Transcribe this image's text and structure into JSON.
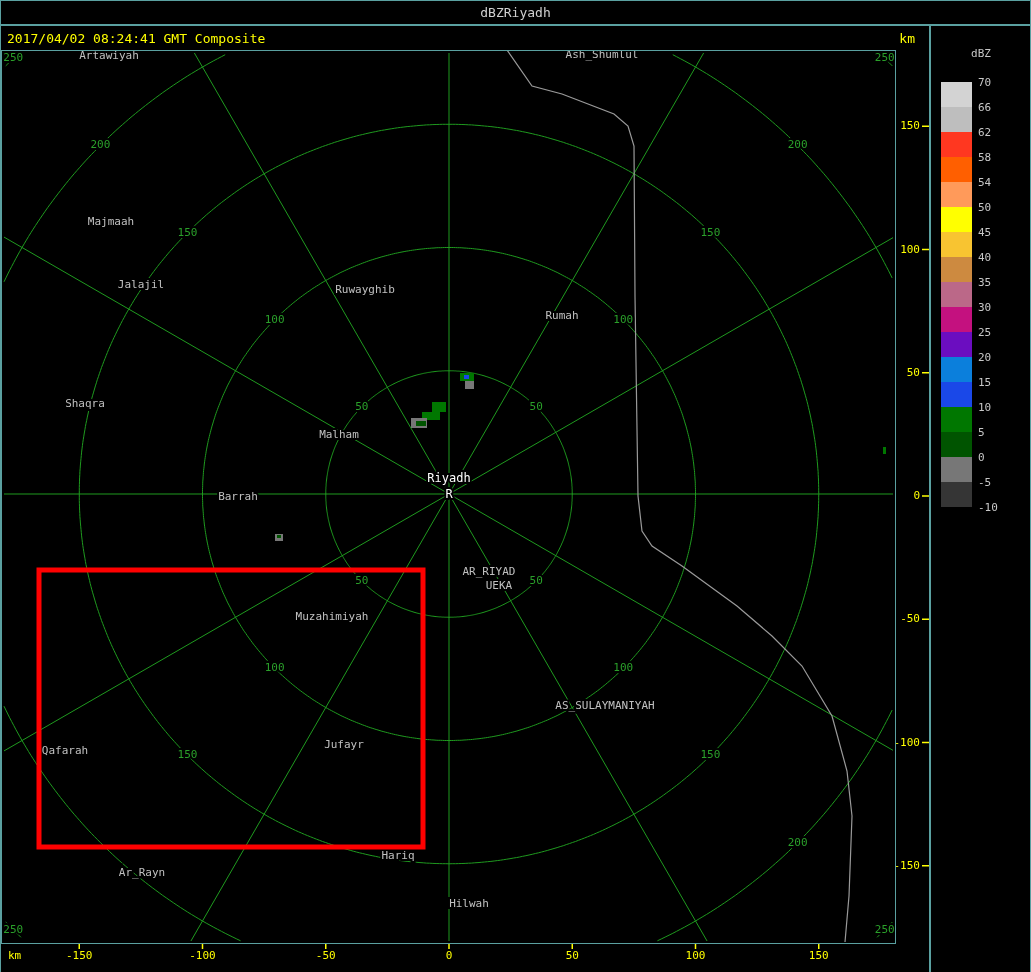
{
  "window": {
    "title": "dBZRiyadh"
  },
  "header": {
    "timestamp": "2017/04/02 08:24:41 GMT Composite",
    "unit": "km"
  },
  "map": {
    "rings": [
      {
        "labels": [
          {
            "text": "50",
            "kind": "nw"
          },
          {
            "text": "50",
            "kind": "ne"
          },
          {
            "text": "50",
            "kind": "sw"
          },
          {
            "text": "50",
            "kind": "se"
          }
        ]
      },
      {
        "labels": [
          {
            "text": "100",
            "kind": "nw"
          },
          {
            "text": "100",
            "kind": "ne"
          },
          {
            "text": "100",
            "kind": "sw"
          },
          {
            "text": "100",
            "kind": "se"
          }
        ]
      },
      {
        "labels": [
          {
            "text": "150",
            "kind": "nw"
          },
          {
            "text": "150",
            "kind": "ne"
          },
          {
            "text": "150",
            "kind": "sw"
          },
          {
            "text": "150",
            "kind": "se"
          }
        ]
      },
      {
        "labels": [
          {
            "text": "200",
            "kind": "nw"
          },
          {
            "text": "200",
            "kind": "ne"
          },
          {
            "text": "200",
            "kind": "se"
          }
        ]
      },
      {
        "labels": [
          {
            "text": "250",
            "kind": "nw"
          },
          {
            "text": "250",
            "kind": "ne"
          },
          {
            "text": "250",
            "kind": "sw"
          },
          {
            "text": "250",
            "kind": "se"
          }
        ]
      }
    ],
    "places": [
      {
        "name": "Artawiyah",
        "kind": "city"
      },
      {
        "name": "Ash_Shumlul",
        "kind": "city"
      },
      {
        "name": "Majmaah",
        "kind": "city"
      },
      {
        "name": "Jalajil",
        "kind": "city"
      },
      {
        "name": "Ruwayghib",
        "kind": "city"
      },
      {
        "name": "Rumah",
        "kind": "city"
      },
      {
        "name": "Shaqra",
        "kind": "city"
      },
      {
        "name": "Malham",
        "kind": "city"
      },
      {
        "name": "Riyadh",
        "kind": "radar"
      },
      {
        "name": "R",
        "kind": "radar"
      },
      {
        "name": "Barrah",
        "kind": "city"
      },
      {
        "name": "AR_RIYAD",
        "kind": "city"
      },
      {
        "name": "UEKA",
        "kind": "city"
      },
      {
        "name": "Muzahimiyah",
        "kind": "city"
      },
      {
        "name": "AS_SULAYMANIYAH",
        "kind": "city"
      },
      {
        "name": "Qafarah",
        "kind": "city"
      },
      {
        "name": "Jufayr",
        "kind": "city"
      },
      {
        "name": "Hariq",
        "kind": "city"
      },
      {
        "name": "Ar_Rayn",
        "kind": "city"
      },
      {
        "name": "Hilwah",
        "kind": "city"
      }
    ],
    "annotations": [
      {
        "kind": "rectangle"
      }
    ]
  },
  "y_axis": {
    "ticks": [
      "150",
      "100",
      "50",
      "0",
      "-50",
      "-100",
      "-150"
    ]
  },
  "x_axis": {
    "unit": "km",
    "ticks": [
      "-150",
      "-100",
      "-50",
      "0",
      "50",
      "100",
      "150"
    ]
  },
  "legend": {
    "title": "dBZ",
    "bins": [
      {
        "color": "#d3d3d3"
      },
      {
        "color": "#bebebe"
      },
      {
        "color": "#ff3720"
      },
      {
        "color": "#ff5f00"
      },
      {
        "color": "#ff9a5a"
      },
      {
        "color": "#ffff00"
      },
      {
        "color": "#f8c431"
      },
      {
        "color": "#cd8a40"
      },
      {
        "color": "#bb6888"
      },
      {
        "color": "#c4117f"
      },
      {
        "color": "#6b0dc0"
      },
      {
        "color": "#0b7fdc"
      },
      {
        "color": "#1a48e8"
      },
      {
        "color": "#007700"
      },
      {
        "color": "#005400"
      },
      {
        "color": "#777777"
      },
      {
        "color": "#353535"
      }
    ],
    "labels": [
      "70",
      "66",
      "62",
      "58",
      "54",
      "50",
      "45",
      "40",
      "35",
      "30",
      "25",
      "20",
      "15",
      "10",
      "5",
      "0",
      "-5",
      "-10"
    ]
  }
}
